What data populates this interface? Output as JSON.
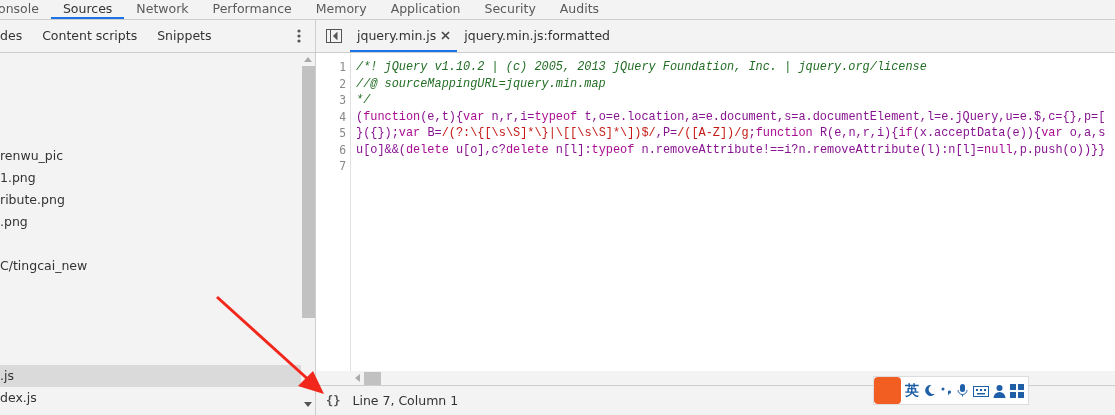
{
  "main_tabs": [
    {
      "label": "onsole",
      "selected": false
    },
    {
      "label": "Sources",
      "selected": true
    },
    {
      "label": "Network",
      "selected": false
    },
    {
      "label": "Performance",
      "selected": false
    },
    {
      "label": "Memory",
      "selected": false
    },
    {
      "label": "Application",
      "selected": false
    },
    {
      "label": "Security",
      "selected": false
    },
    {
      "label": "Audits",
      "selected": false
    }
  ],
  "sidebar": {
    "tabs": [
      {
        "label": "des",
        "selected": false
      },
      {
        "label": "Content scripts",
        "selected": false
      },
      {
        "label": "Snippets",
        "selected": false
      }
    ],
    "items": [
      {
        "label": "renwu_pic",
        "selected": false
      },
      {
        "label": "1.png",
        "selected": false
      },
      {
        "label": "ribute.png",
        "selected": false
      },
      {
        "label": ".png",
        "selected": false
      },
      {
        "label": "C/tingcai_new",
        "selected": false
      },
      {
        "label": ".js",
        "selected": true
      },
      {
        "label": "dex.js",
        "selected": false
      }
    ]
  },
  "editor": {
    "tabs": [
      {
        "label": "jquery.min.js",
        "selected": true,
        "closable": true
      },
      {
        "label": "jquery.min.js:formatted",
        "selected": false,
        "closable": false
      }
    ],
    "lines": [
      {
        "number": "1",
        "tokens": [
          {
            "kind": "comment",
            "text": "/*! jQuery v1.10.2 | (c) 2005, 2013 jQuery Foundation, Inc. | jquery.org/license"
          }
        ]
      },
      {
        "number": "2",
        "tokens": [
          {
            "kind": "comment",
            "text": "//@ sourceMappingURL=jquery.min.map"
          }
        ]
      },
      {
        "number": "3",
        "tokens": [
          {
            "kind": "comment",
            "text": "*/"
          }
        ]
      },
      {
        "number": "4",
        "tokens": [
          {
            "kind": "plain",
            "text": "("
          },
          {
            "kind": "keyword",
            "text": "function"
          },
          {
            "kind": "plain",
            "text": "(e,t){"
          },
          {
            "kind": "keyword",
            "text": "var"
          },
          {
            "kind": "plain",
            "text": " n,r,i="
          },
          {
            "kind": "keyword",
            "text": "typeof"
          },
          {
            "kind": "plain",
            "text": " t,o=e.location,a=e.document,s=a.documentElement,l=e.jQuery,u=e.$,c={},p=["
          }
        ]
      },
      {
        "number": "5",
        "tokens": [
          {
            "kind": "plain",
            "text": "}({});"
          },
          {
            "kind": "keyword",
            "text": "var"
          },
          {
            "kind": "plain",
            "text": " B="
          },
          {
            "kind": "regex",
            "text": "/(?:\\{[\\s\\S]*\\}|\\[[\\s\\S]*\\])$/"
          },
          {
            "kind": "plain",
            "text": ",P="
          },
          {
            "kind": "regex",
            "text": "/([A-Z])/g"
          },
          {
            "kind": "plain",
            "text": ";"
          },
          {
            "kind": "keyword",
            "text": "function"
          },
          {
            "kind": "plain",
            "text": " R(e,n,r,i){"
          },
          {
            "kind": "keyword",
            "text": "if"
          },
          {
            "kind": "plain",
            "text": "(x.acceptData(e)){"
          },
          {
            "kind": "keyword",
            "text": "var"
          },
          {
            "kind": "plain",
            "text": " o,a,s"
          }
        ]
      },
      {
        "number": "6",
        "tokens": [
          {
            "kind": "plain",
            "text": "u[o]&&("
          },
          {
            "kind": "keyword",
            "text": "delete"
          },
          {
            "kind": "plain",
            "text": " u[o],c?"
          },
          {
            "kind": "keyword",
            "text": "delete"
          },
          {
            "kind": "plain",
            "text": " n[l]:"
          },
          {
            "kind": "keyword",
            "text": "typeof"
          },
          {
            "kind": "plain",
            "text": " n.removeAttribute!==i?n.removeAttribute(l):n[l]="
          },
          {
            "kind": "keyword",
            "text": "null"
          },
          {
            "kind": "plain",
            "text": ",p.push(o))}}"
          }
        ]
      },
      {
        "number": "7"
      }
    ]
  },
  "status_bar": {
    "pretty_print": "{}",
    "position": "Line 7, Column 1"
  },
  "ime_toolbar": {
    "language": "英"
  }
}
